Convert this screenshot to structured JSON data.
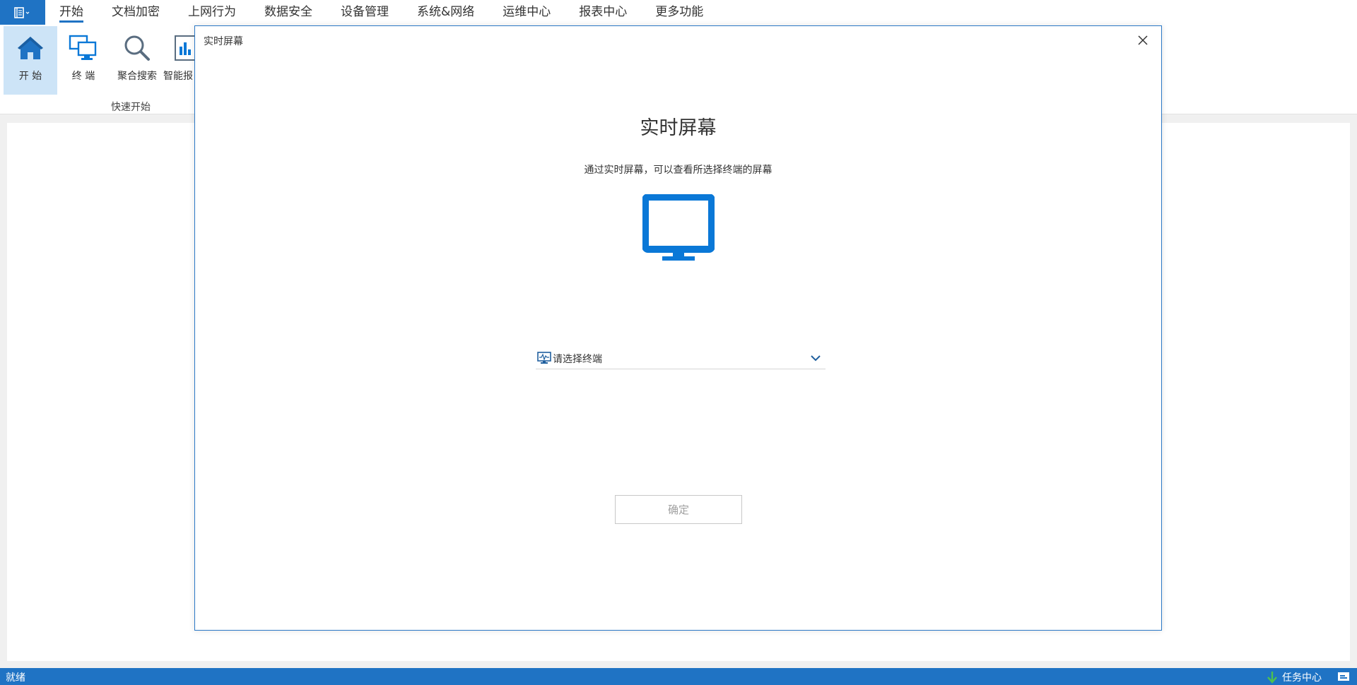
{
  "menubar": {
    "app_icon": "app-menu-icon",
    "tabs": [
      {
        "label": "开始",
        "active": true
      },
      {
        "label": "文档加密"
      },
      {
        "label": "上网行为"
      },
      {
        "label": "数据安全"
      },
      {
        "label": "设备管理"
      },
      {
        "label": "系统&网络"
      },
      {
        "label": "运维中心"
      },
      {
        "label": "报表中心"
      },
      {
        "label": "更多功能"
      }
    ]
  },
  "ribbon": {
    "buttons": [
      {
        "label": "开 始",
        "icon": "home-icon",
        "active": true
      },
      {
        "label": "终 端",
        "icon": "terminal-icon"
      },
      {
        "label": "聚合搜索",
        "icon": "search-icon"
      },
      {
        "label": "智能报",
        "icon": "report-icon"
      }
    ],
    "group_label": "快速开始"
  },
  "dialog": {
    "title": "实时屏幕",
    "heading": "实时屏幕",
    "description": "通过实时屏幕，可以查看所选择终端的屏幕",
    "main_icon": "monitor-icon",
    "select": {
      "placeholder": "请选择终端",
      "icon": "terminal-monitor-icon"
    },
    "ok_label": "确定",
    "close_icon": "close-icon"
  },
  "statusbar": {
    "status": "就绪",
    "task_center": "任务中心"
  },
  "colors": {
    "accent": "#1f73c4",
    "icon_blue": "#0a78d7",
    "active_bg": "#cde4f7"
  }
}
